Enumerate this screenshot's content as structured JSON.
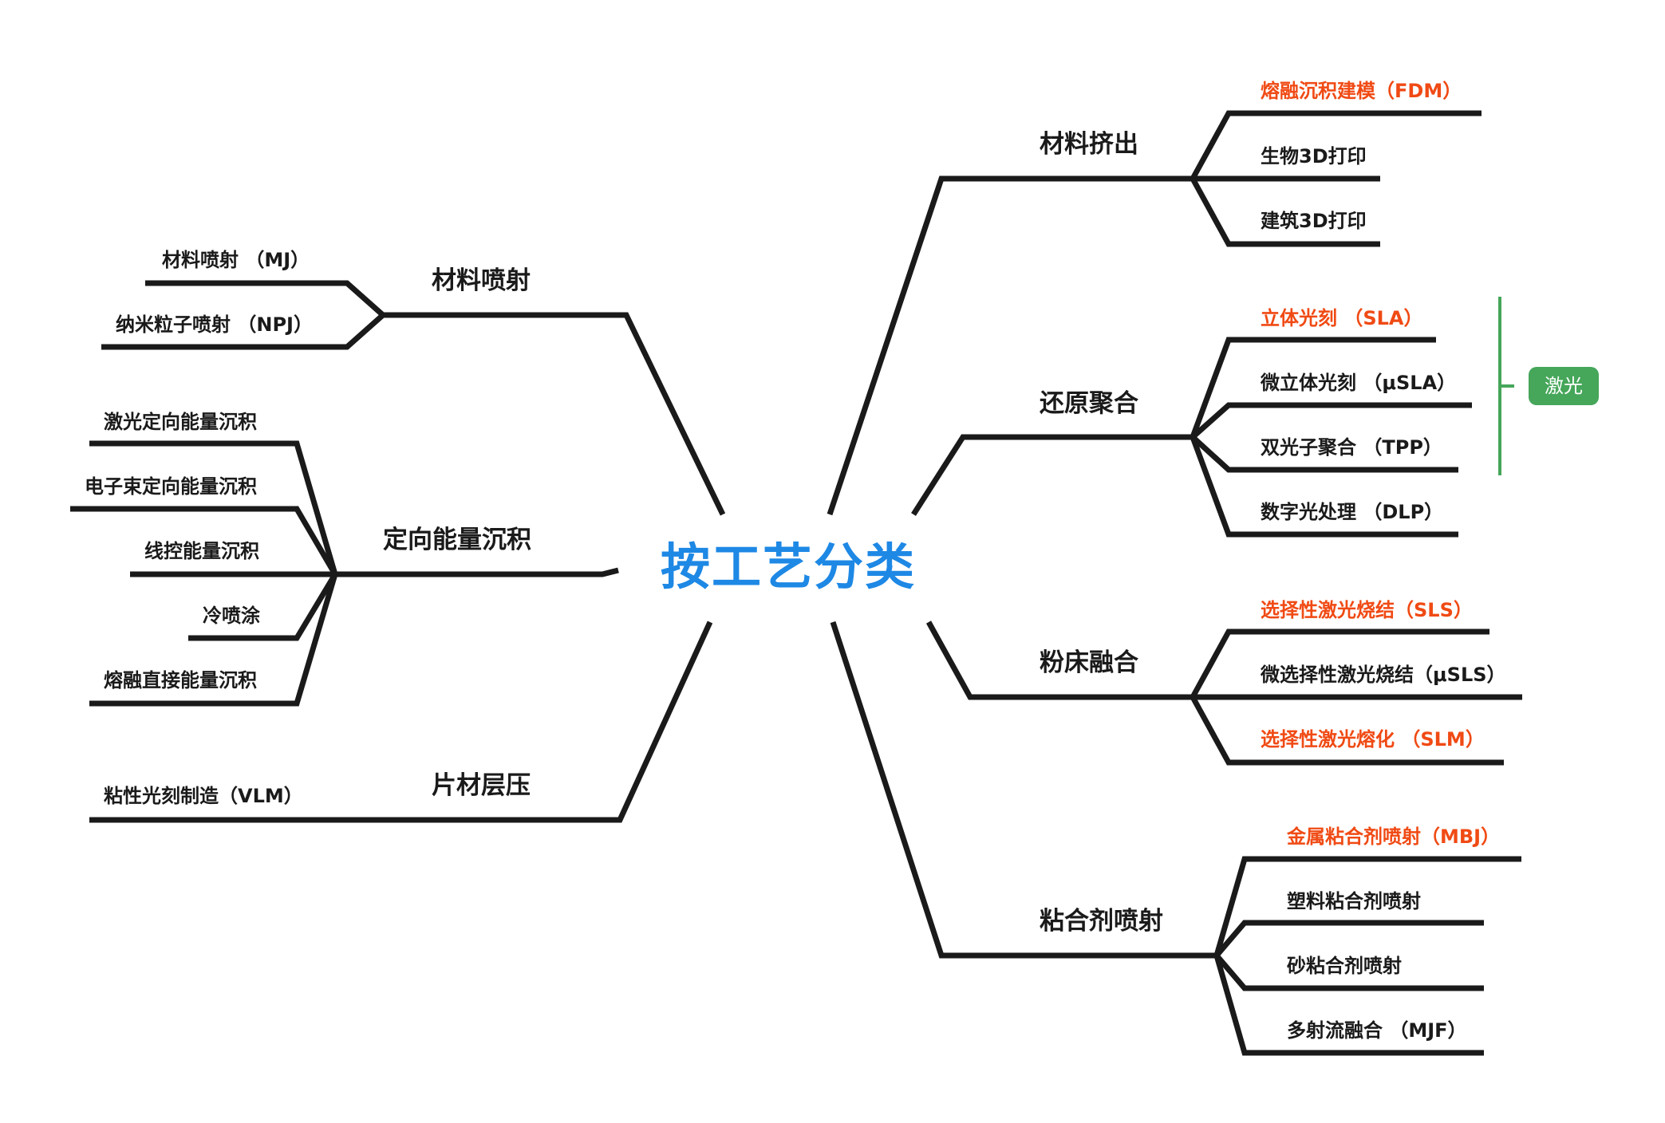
{
  "root": "按工艺分类",
  "left": [
    {
      "label": "材料喷射",
      "children": [
        "材料喷射 （MJ）",
        "纳米粒子喷射 （NPJ）"
      ]
    },
    {
      "label": "定向能量沉积",
      "children": [
        "激光定向能量沉积",
        "电子束定向能量沉积",
        "线控能量沉积",
        "冷喷涂",
        "熔融直接能量沉积"
      ]
    },
    {
      "label": "片材层压",
      "children": [
        "粘性光刻制造（VLM）"
      ]
    }
  ],
  "right": [
    {
      "label": "材料挤出",
      "children": [
        {
          "text": "熔融沉积建模（FDM）",
          "highlight": true
        },
        {
          "text": "生物3D打印",
          "highlight": false
        },
        {
          "text": "建筑3D打印",
          "highlight": false
        }
      ]
    },
    {
      "label": "还原聚合",
      "children": [
        {
          "text": "立体光刻 （SLA）",
          "highlight": true
        },
        {
          "text": "微立体光刻 （μSLA）",
          "highlight": false
        },
        {
          "text": "双光子聚合 （TPP）",
          "highlight": false
        },
        {
          "text": "数字光处理 （DLP）",
          "highlight": false
        }
      ]
    },
    {
      "label": "粉床融合",
      "children": [
        {
          "text": "选择性激光烧结（SLS）",
          "highlight": true
        },
        {
          "text": "微选择性激光烧结（μSLS）",
          "highlight": false
        },
        {
          "text": "选择性激光熔化 （SLM）",
          "highlight": true
        }
      ]
    },
    {
      "label": "粘合剂喷射",
      "children": [
        {
          "text": "金属粘合剂喷射（MBJ）",
          "highlight": true
        },
        {
          "text": "塑料粘合剂喷射",
          "highlight": false
        },
        {
          "text": "砂粘合剂喷射",
          "highlight": false
        },
        {
          "text": "多射流融合 （MJF）",
          "highlight": false
        }
      ]
    }
  ],
  "annotation": {
    "label": "激光"
  },
  "colors": {
    "line": "#1a1a1a",
    "root": "#1e88e5",
    "highlight": "#f04a14",
    "annotation": "#46a65a"
  }
}
